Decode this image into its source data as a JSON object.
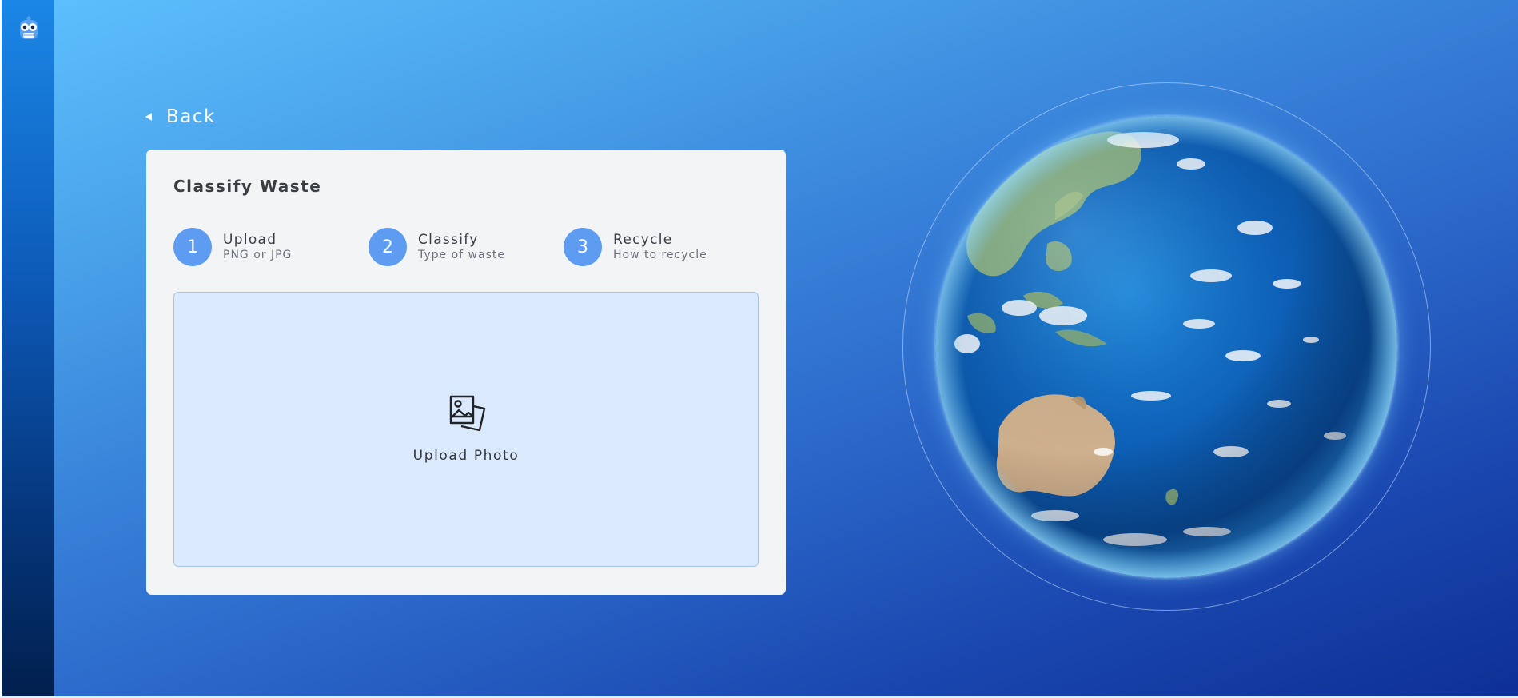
{
  "nav": {
    "back_label": "Back"
  },
  "card": {
    "title": "Classify Waste",
    "steps": [
      {
        "number": "1",
        "title": "Upload",
        "subtitle": "PNG or JPG"
      },
      {
        "number": "2",
        "title": "Classify",
        "subtitle": "Type of waste"
      },
      {
        "number": "3",
        "title": "Recycle",
        "subtitle": "How to recycle"
      }
    ],
    "dropzone": {
      "label": "Upload Photo",
      "icon": "photos-icon"
    }
  },
  "icons": {
    "logo": "owl-logo-icon",
    "back": "caret-left-icon",
    "globe": "earth-globe"
  },
  "colors": {
    "accent": "#5d9cf0",
    "card_bg": "#f3f4f6",
    "dropzone_bg": "#dbe9fd",
    "background_top": "#5ec1ff",
    "background_bottom": "#0d2f95"
  }
}
